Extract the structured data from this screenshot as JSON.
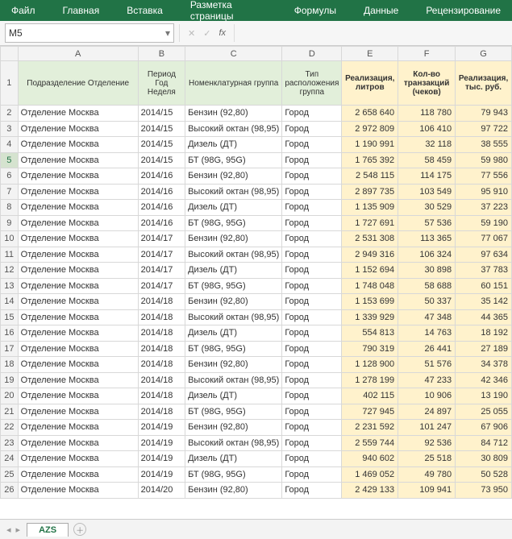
{
  "ribbon": [
    "Файл",
    "Главная",
    "Вставка",
    "Разметка страницы",
    "Формулы",
    "Данные",
    "Рецензирование"
  ],
  "namebox": "M5",
  "fx": "fx",
  "cols": [
    "A",
    "B",
    "C",
    "D",
    "E",
    "F",
    "G"
  ],
  "headers": {
    "A": "Подразделение Отделение",
    "B": "Период Год Неделя",
    "C": "Номенклатурная группа",
    "D": "Тип расположения группа",
    "E": "Реализация, литров",
    "F": "Кол-во транзакций (чеков)",
    "G": "Реализация, тыс. руб."
  },
  "rows": [
    {
      "n": 2,
      "a": "Отделение Москва",
      "b": "2014/15",
      "c": "Бензин (92,80)",
      "d": "Город",
      "e": "2 658 640",
      "f": "118 780",
      "g": "79 943"
    },
    {
      "n": 3,
      "a": "Отделение Москва",
      "b": "2014/15",
      "c": "Высокий октан (98,95)",
      "d": "Город",
      "e": "2 972 809",
      "f": "106 410",
      "g": "97 722"
    },
    {
      "n": 4,
      "a": "Отделение Москва",
      "b": "2014/15",
      "c": "Дизель (ДТ)",
      "d": "Город",
      "e": "1 190 991",
      "f": "32 118",
      "g": "38 555"
    },
    {
      "n": 5,
      "a": "Отделение Москва",
      "b": "2014/15",
      "c": "БТ (98G, 95G)",
      "d": "Город",
      "e": "1 765 392",
      "f": "58 459",
      "g": "59 980"
    },
    {
      "n": 6,
      "a": "Отделение Москва",
      "b": "2014/16",
      "c": "Бензин (92,80)",
      "d": "Город",
      "e": "2 548 115",
      "f": "114 175",
      "g": "77 556"
    },
    {
      "n": 7,
      "a": "Отделение Москва",
      "b": "2014/16",
      "c": "Высокий октан (98,95)",
      "d": "Город",
      "e": "2 897 735",
      "f": "103 549",
      "g": "95 910"
    },
    {
      "n": 8,
      "a": "Отделение Москва",
      "b": "2014/16",
      "c": "Дизель (ДТ)",
      "d": "Город",
      "e": "1 135 909",
      "f": "30 529",
      "g": "37 223"
    },
    {
      "n": 9,
      "a": "Отделение Москва",
      "b": "2014/16",
      "c": "БТ (98G, 95G)",
      "d": "Город",
      "e": "1 727 691",
      "f": "57 536",
      "g": "59 190"
    },
    {
      "n": 10,
      "a": "Отделение Москва",
      "b": "2014/17",
      "c": "Бензин (92,80)",
      "d": "Город",
      "e": "2 531 308",
      "f": "113 365",
      "g": "77 067"
    },
    {
      "n": 11,
      "a": "Отделение Москва",
      "b": "2014/17",
      "c": "Высокий октан (98,95)",
      "d": "Город",
      "e": "2 949 316",
      "f": "106 324",
      "g": "97 634"
    },
    {
      "n": 12,
      "a": "Отделение Москва",
      "b": "2014/17",
      "c": "Дизель (ДТ)",
      "d": "Город",
      "e": "1 152 694",
      "f": "30 898",
      "g": "37 783"
    },
    {
      "n": 13,
      "a": "Отделение Москва",
      "b": "2014/17",
      "c": "БТ (98G, 95G)",
      "d": "Город",
      "e": "1 748 048",
      "f": "58 688",
      "g": "60 151"
    },
    {
      "n": 14,
      "a": "Отделение Москва",
      "b": "2014/18",
      "c": "Бензин (92,80)",
      "d": "Город",
      "e": "1 153 699",
      "f": "50 337",
      "g": "35 142"
    },
    {
      "n": 15,
      "a": "Отделение Москва",
      "b": "2014/18",
      "c": "Высокий октан (98,95)",
      "d": "Город",
      "e": "1 339 929",
      "f": "47 348",
      "g": "44 365"
    },
    {
      "n": 16,
      "a": "Отделение Москва",
      "b": "2014/18",
      "c": "Дизель (ДТ)",
      "d": "Город",
      "e": "554 813",
      "f": "14 763",
      "g": "18 192"
    },
    {
      "n": 17,
      "a": "Отделение Москва",
      "b": "2014/18",
      "c": "БТ (98G, 95G)",
      "d": "Город",
      "e": "790 319",
      "f": "26 441",
      "g": "27 189"
    },
    {
      "n": 18,
      "a": "Отделение Москва",
      "b": "2014/18",
      "c": "Бензин (92,80)",
      "d": "Город",
      "e": "1 128 900",
      "f": "51 576",
      "g": "34 378"
    },
    {
      "n": 19,
      "a": "Отделение Москва",
      "b": "2014/18",
      "c": "Высокий октан (98,95)",
      "d": "Город",
      "e": "1 278 199",
      "f": "47 233",
      "g": "42 346"
    },
    {
      "n": 20,
      "a": "Отделение Москва",
      "b": "2014/18",
      "c": "Дизель (ДТ)",
      "d": "Город",
      "e": "402 115",
      "f": "10 906",
      "g": "13 190"
    },
    {
      "n": 21,
      "a": "Отделение Москва",
      "b": "2014/18",
      "c": "БТ (98G, 95G)",
      "d": "Город",
      "e": "727 945",
      "f": "24 897",
      "g": "25 055"
    },
    {
      "n": 22,
      "a": "Отделение Москва",
      "b": "2014/19",
      "c": "Бензин (92,80)",
      "d": "Город",
      "e": "2 231 592",
      "f": "101 247",
      "g": "67 906"
    },
    {
      "n": 23,
      "a": "Отделение Москва",
      "b": "2014/19",
      "c": "Высокий октан (98,95)",
      "d": "Город",
      "e": "2 559 744",
      "f": "92 536",
      "g": "84 712"
    },
    {
      "n": 24,
      "a": "Отделение Москва",
      "b": "2014/19",
      "c": "Дизель (ДТ)",
      "d": "Город",
      "e": "940 602",
      "f": "25 518",
      "g": "30 809"
    },
    {
      "n": 25,
      "a": "Отделение Москва",
      "b": "2014/19",
      "c": "БТ (98G, 95G)",
      "d": "Город",
      "e": "1 469 052",
      "f": "49 780",
      "g": "50 528"
    },
    {
      "n": 26,
      "a": "Отделение Москва",
      "b": "2014/20",
      "c": "Бензин (92,80)",
      "d": "Город",
      "e": "2 429 133",
      "f": "109 941",
      "g": "73 950"
    }
  ],
  "tab": "AZS",
  "selectedRow": 5
}
